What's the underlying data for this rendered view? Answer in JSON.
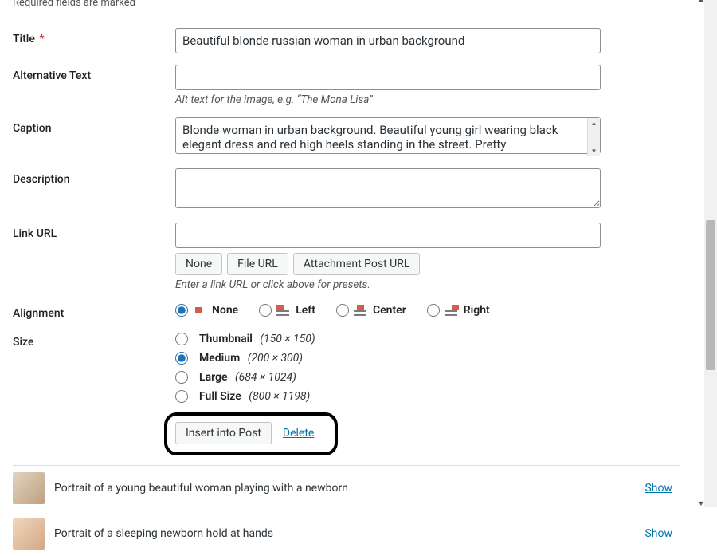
{
  "notice": "Required fields are marked",
  "fields": {
    "title": {
      "label": "Title",
      "required": true,
      "value": "Beautiful blonde russian woman in urban background"
    },
    "alt": {
      "label": "Alternative Text",
      "value": "",
      "helper": "Alt text for the image, e.g. “The Mona Lisa”"
    },
    "caption": {
      "label": "Caption",
      "value": "Blonde woman in urban background. Beautiful young girl wearing black elegant dress and red high heels standing in the street. Pretty"
    },
    "description": {
      "label": "Description",
      "value": ""
    },
    "link_url": {
      "label": "Link URL",
      "value": "",
      "buttons": {
        "none": "None",
        "file": "File URL",
        "post": "Attachment Post URL"
      },
      "helper": "Enter a link URL or click above for presets."
    },
    "alignment": {
      "label": "Alignment",
      "options": {
        "none": "None",
        "left": "Left",
        "center": "Center",
        "right": "Right"
      },
      "selected": "none"
    },
    "size": {
      "label": "Size",
      "options": {
        "thumbnail": {
          "name": "Thumbnail",
          "dim": "(150 × 150)"
        },
        "medium": {
          "name": "Medium",
          "dim": "(200 × 300)"
        },
        "large": {
          "name": "Large",
          "dim": "(684 × 1024)"
        },
        "full": {
          "name": "Full Size",
          "dim": "(800 × 1198)"
        }
      },
      "selected": "medium"
    }
  },
  "actions": {
    "insert": "Insert into Post",
    "delete": "Delete"
  },
  "attachments": [
    {
      "title": "Portrait of a young beautiful woman playing with a newborn",
      "toggle": "Show"
    },
    {
      "title": "Portrait of a sleeping newborn hold at hands",
      "toggle": "Show"
    }
  ]
}
